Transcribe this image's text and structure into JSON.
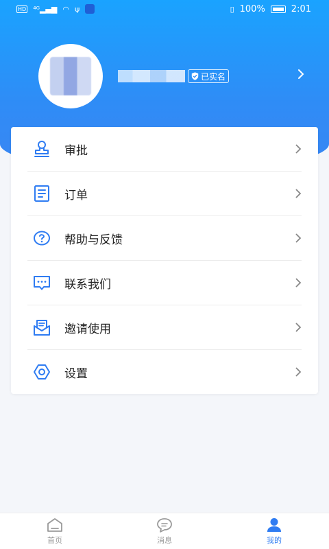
{
  "status_bar": {
    "left": [
      "HD",
      "4G",
      "····",
      "WiFi",
      "✦"
    ],
    "battery_text": "100%",
    "time": "2:01"
  },
  "profile": {
    "verified_label": "已实名"
  },
  "menu": {
    "items": [
      {
        "label": "审批",
        "icon": "stamp-icon"
      },
      {
        "label": "订单",
        "icon": "order-list-icon"
      },
      {
        "label": "帮助与反馈",
        "icon": "help-icon"
      },
      {
        "label": "联系我们",
        "icon": "message-icon"
      },
      {
        "label": "邀请使用",
        "icon": "invite-icon"
      },
      {
        "label": "设置",
        "icon": "gear-icon"
      }
    ]
  },
  "tabbar": {
    "tabs": [
      {
        "label": "首页",
        "icon": "home-icon",
        "active": false
      },
      {
        "label": "消息",
        "icon": "chat-icon",
        "active": false
      },
      {
        "label": "我的",
        "icon": "person-icon",
        "active": true
      }
    ]
  },
  "colors": {
    "accent": "#2f7cf2",
    "hero_top": "#1aa3ff",
    "hero_bottom": "#3a86f3",
    "icon_blue": "#2f7cf2"
  }
}
